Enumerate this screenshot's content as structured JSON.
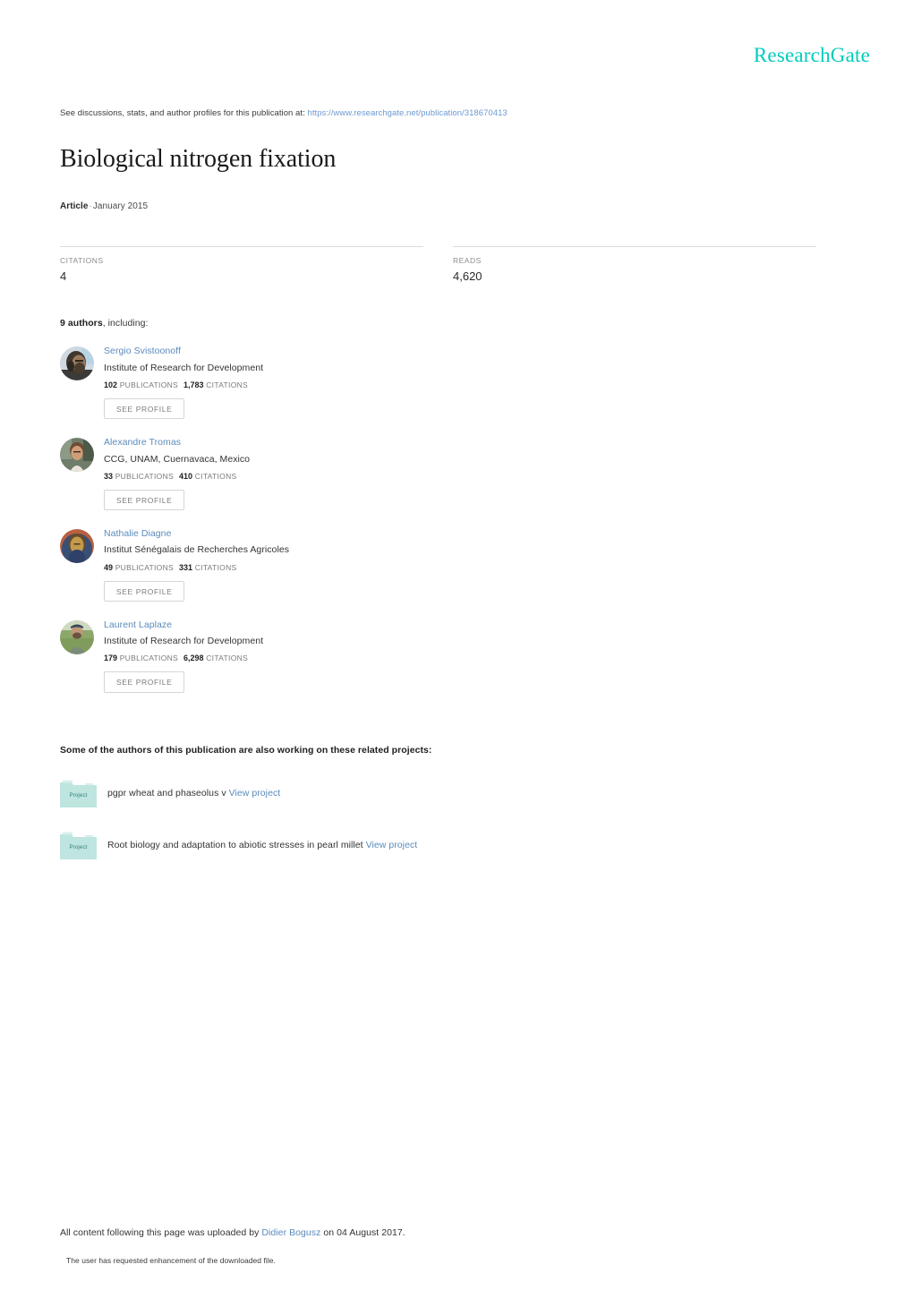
{
  "brand": {
    "name": "ResearchGate",
    "color": "#00ccbb"
  },
  "header": {
    "discussion_prefix": "See discussions, stats, and author profiles for this publication at:",
    "publication_url": "https://www.researchgate.net/publication/318670413"
  },
  "publication": {
    "title": "Biological nitrogen fixation",
    "type": "Article",
    "separator": "·",
    "date": "January 2015"
  },
  "stats": [
    {
      "label": "CITATIONS",
      "value": "4"
    },
    {
      "label": "READS",
      "value": "4,620"
    }
  ],
  "authors_section": {
    "count_label": "9 authors",
    "including_label": ", including:",
    "see_profile_label": "SEE PROFILE",
    "publications_label": "PUBLICATIONS",
    "citations_label": "CITATIONS"
  },
  "authors": [
    {
      "name": "Sergio Svistoonoff",
      "affiliation": "Institute of Research for Development",
      "publications": "102",
      "publications_label": "PUBLICATIONS",
      "citations": "1,783",
      "citations_label": "CITATIONS",
      "button": "SEE PROFILE"
    },
    {
      "name": "Alexandre Tromas",
      "affiliation": "CCG, UNAM, Cuernavaca, Mexico",
      "publications": "33",
      "publications_label": "PUBLICATIONS",
      "citations": "410",
      "citations_label": "CITATIONS",
      "button": "SEE PROFILE"
    },
    {
      "name": "Nathalie Diagne",
      "affiliation": "Institut Sénégalais de Recherches Agricoles",
      "publications": "49",
      "publications_label": "PUBLICATIONS",
      "citations": "331",
      "citations_label": "CITATIONS",
      "button": "SEE PROFILE"
    },
    {
      "name": "Laurent Laplaze",
      "affiliation": "Institute of Research for Development",
      "publications": "179",
      "publications_label": "PUBLICATIONS",
      "citations": "6,298",
      "citations_label": "CITATIONS",
      "button": "SEE PROFILE"
    }
  ],
  "projects_section": {
    "heading": "Some of the authors of this publication are also working on these related projects:",
    "icon_label": "Project"
  },
  "projects": [
    {
      "title": "pgpr wheat and phaseolus v",
      "link_label": "View project"
    },
    {
      "title": "Root biology and adaptation to abiotic stresses in pearl millet",
      "link_label": "View project"
    }
  ],
  "footer": {
    "upload_prefix": "All content following this page was uploaded by",
    "uploader": "Didier Bogusz",
    "upload_suffix": "on 04 August 2017.",
    "note": "The user has requested enhancement of the downloaded file."
  }
}
